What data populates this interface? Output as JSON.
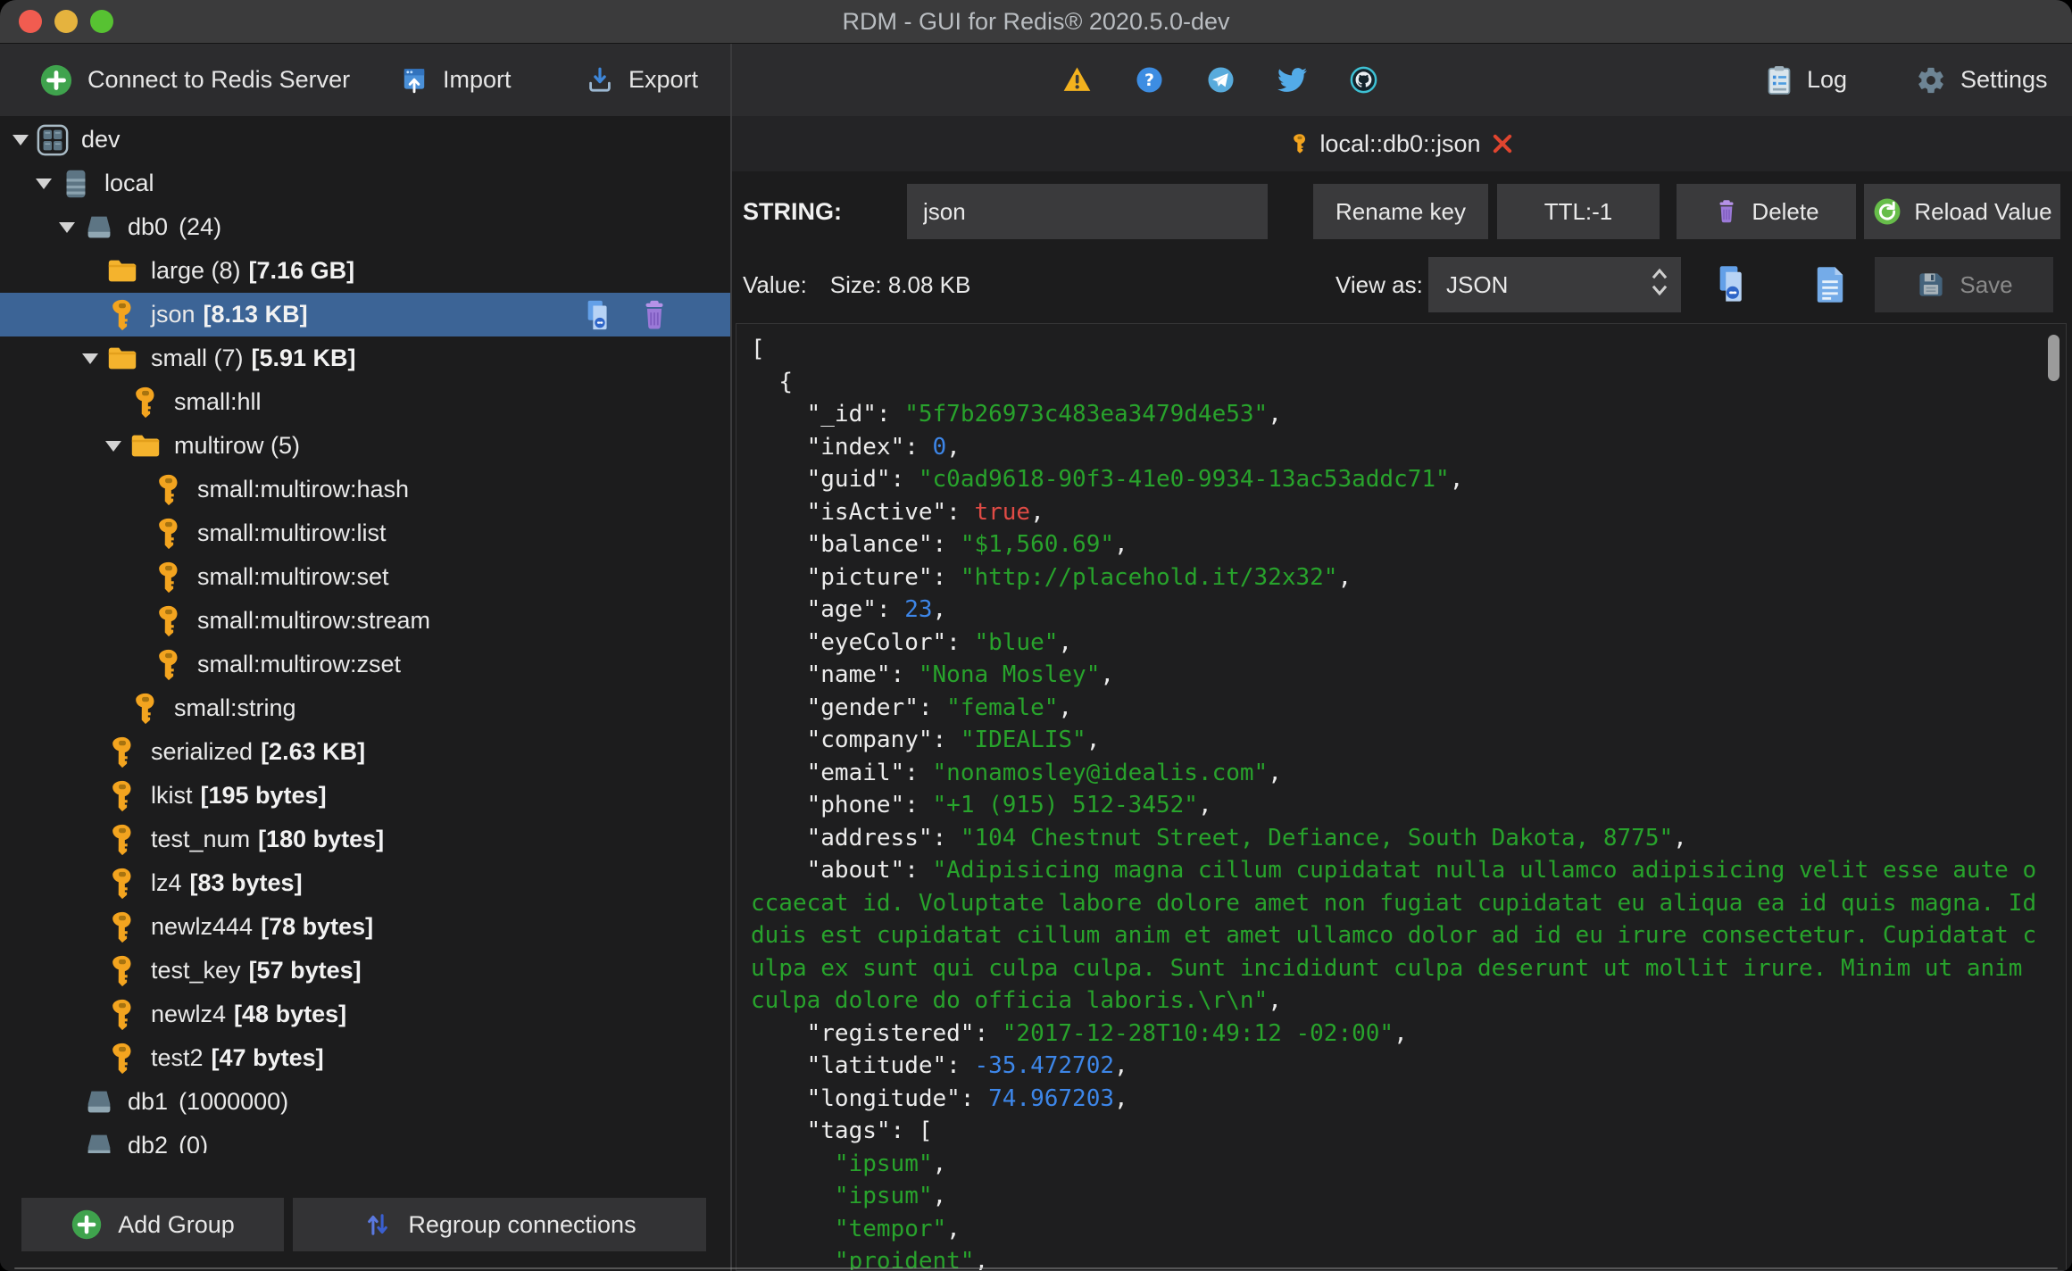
{
  "window": {
    "title": "RDM - GUI for Redis® 2020.5.0-dev"
  },
  "toolbar": {
    "connect": "Connect to Redis Server",
    "import": "Import",
    "export": "Export",
    "log": "Log",
    "settings": "Settings"
  },
  "sidebar": {
    "add_group": "Add Group",
    "regroup": "Regroup connections",
    "tree": [
      {
        "label": "dev",
        "type": "connection",
        "level": 0,
        "expanded": true
      },
      {
        "label": "local",
        "type": "server",
        "level": 1,
        "expanded": true
      },
      {
        "label": "db0",
        "count": "(24)",
        "type": "database",
        "level": 2,
        "expanded": true
      },
      {
        "label": "large (8)",
        "size": "[7.16 GB]",
        "type": "folder",
        "level": 3
      },
      {
        "label": "json",
        "size": "[8.13 KB]",
        "type": "key",
        "level": 3,
        "selected": true
      },
      {
        "label": "small (7)",
        "size": "[5.91 KB]",
        "type": "folder",
        "level": 3,
        "expanded": true
      },
      {
        "label": "small:hll",
        "type": "key",
        "level": 4
      },
      {
        "label": "multirow (5)",
        "type": "folder",
        "level": 4,
        "expanded": true
      },
      {
        "label": "small:multirow:hash",
        "type": "key",
        "level": 5
      },
      {
        "label": "small:multirow:list",
        "type": "key",
        "level": 5
      },
      {
        "label": "small:multirow:set",
        "type": "key",
        "level": 5
      },
      {
        "label": "small:multirow:stream",
        "type": "key",
        "level": 5
      },
      {
        "label": "small:multirow:zset",
        "type": "key",
        "level": 5
      },
      {
        "label": "small:string",
        "type": "key",
        "level": 4
      },
      {
        "label": "serialized",
        "size": "[2.63 KB]",
        "type": "key",
        "level": 3
      },
      {
        "label": "lkist",
        "size": "[195 bytes]",
        "type": "key",
        "level": 3
      },
      {
        "label": "test_num",
        "size": "[180 bytes]",
        "type": "key",
        "level": 3
      },
      {
        "label": "lz4",
        "size": "[83 bytes]",
        "type": "key",
        "level": 3
      },
      {
        "label": "newlz444",
        "size": "[78 bytes]",
        "type": "key",
        "level": 3
      },
      {
        "label": "test_key",
        "size": "[57 bytes]",
        "type": "key",
        "level": 3
      },
      {
        "label": "newlz4",
        "size": "[48 bytes]",
        "type": "key",
        "level": 3
      },
      {
        "label": "test2",
        "size": "[47 bytes]",
        "type": "key",
        "level": 3
      },
      {
        "label": "db1",
        "count": "(1000000)",
        "type": "database",
        "level": 2
      },
      {
        "label": "db2",
        "count": "(0)",
        "type": "database",
        "level": 2
      }
    ]
  },
  "editor": {
    "tab": {
      "title": "local::db0::json"
    },
    "type_label": "STRING:",
    "key_name": "json",
    "rename_button": "Rename key",
    "ttl_button": "TTL:-1",
    "delete_button": "Delete",
    "reload_button": "Reload Value",
    "value_label": "Value:",
    "size_label": "Size: 8.08 KB",
    "view_as_label": "View as:",
    "view_as_value": "JSON",
    "save_button": "Save",
    "json_lines": [
      [
        [
          "w",
          "["
        ]
      ],
      [
        [
          "w",
          "  {"
        ]
      ],
      [
        [
          "w",
          "    \"_id\": "
        ],
        [
          "s",
          "\"5f7b26973c483ea3479d4e53\""
        ],
        [
          "w",
          ","
        ]
      ],
      [
        [
          "w",
          "    \"index\": "
        ],
        [
          "n",
          "0"
        ],
        [
          "w",
          ","
        ]
      ],
      [
        [
          "w",
          "    \"guid\": "
        ],
        [
          "s",
          "\"c0ad9618-90f3-41e0-9934-13ac53addc71\""
        ],
        [
          "w",
          ","
        ]
      ],
      [
        [
          "w",
          "    \"isActive\": "
        ],
        [
          "b",
          "true"
        ],
        [
          "w",
          ","
        ]
      ],
      [
        [
          "w",
          "    \"balance\": "
        ],
        [
          "s",
          "\"$1,560.69\""
        ],
        [
          "w",
          ","
        ]
      ],
      [
        [
          "w",
          "    \"picture\": "
        ],
        [
          "s",
          "\"http://placehold.it/32x32\""
        ],
        [
          "w",
          ","
        ]
      ],
      [
        [
          "w",
          "    \"age\": "
        ],
        [
          "n",
          "23"
        ],
        [
          "w",
          ","
        ]
      ],
      [
        [
          "w",
          "    \"eyeColor\": "
        ],
        [
          "s",
          "\"blue\""
        ],
        [
          "w",
          ","
        ]
      ],
      [
        [
          "w",
          "    \"name\": "
        ],
        [
          "s",
          "\"Nona Mosley\""
        ],
        [
          "w",
          ","
        ]
      ],
      [
        [
          "w",
          "    \"gender\": "
        ],
        [
          "s",
          "\"female\""
        ],
        [
          "w",
          ","
        ]
      ],
      [
        [
          "w",
          "    \"company\": "
        ],
        [
          "s",
          "\"IDEALIS\""
        ],
        [
          "w",
          ","
        ]
      ],
      [
        [
          "w",
          "    \"email\": "
        ],
        [
          "s",
          "\"nonamosley@idealis.com\""
        ],
        [
          "w",
          ","
        ]
      ],
      [
        [
          "w",
          "    \"phone\": "
        ],
        [
          "s",
          "\"+1 (915) 512-3452\""
        ],
        [
          "w",
          ","
        ]
      ],
      [
        [
          "w",
          "    \"address\": "
        ],
        [
          "s",
          "\"104 Chestnut Street, Defiance, South Dakota, 8775\""
        ],
        [
          "w",
          ","
        ]
      ],
      [
        [
          "w",
          "    \"about\": "
        ],
        [
          "s",
          "\"Adipisicing magna cillum cupidatat nulla ullamco adipisicing velit esse aute occaecat id. Voluptate labore dolore amet non fugiat cupidatat eu aliqua ea id quis magna. Id duis est cupidatat cillum anim et amet ullamco dolor ad id eu irure consectetur. Cupidatat culpa ex sunt qui culpa culpa. Sunt incididunt culpa deserunt ut mollit irure. Minim ut anim culpa dolore do officia laboris.\\r\\n\""
        ],
        [
          "w",
          ","
        ]
      ],
      [
        [
          "w",
          "    \"registered\": "
        ],
        [
          "s",
          "\"2017-12-28T10:49:12 -02:00\""
        ],
        [
          "w",
          ","
        ]
      ],
      [
        [
          "w",
          "    \"latitude\": "
        ],
        [
          "n",
          "-35.472702"
        ],
        [
          "w",
          ","
        ]
      ],
      [
        [
          "w",
          "    \"longitude\": "
        ],
        [
          "n",
          "74.967203"
        ],
        [
          "w",
          ","
        ]
      ],
      [
        [
          "w",
          "    \"tags\": ["
        ]
      ],
      [
        [
          "w",
          "      "
        ],
        [
          "s",
          "\"ipsum\""
        ],
        [
          "w",
          ","
        ]
      ],
      [
        [
          "w",
          "      "
        ],
        [
          "s",
          "\"ipsum\""
        ],
        [
          "w",
          ","
        ]
      ],
      [
        [
          "w",
          "      "
        ],
        [
          "s",
          "\"tempor\""
        ],
        [
          "w",
          ","
        ]
      ],
      [
        [
          "w",
          "      "
        ],
        [
          "s",
          "\"proident\""
        ],
        [
          "w",
          ","
        ]
      ]
    ]
  },
  "colors": {
    "selection": "#3c6496",
    "json_string": "#28a32c",
    "json_number": "#3d86e8",
    "json_boolean": "#e04b45",
    "key_icon": "#f3a41f",
    "folder_icon": "#f4b32d",
    "close_red": "#e0452f",
    "connect_green": "#3fa34d"
  }
}
